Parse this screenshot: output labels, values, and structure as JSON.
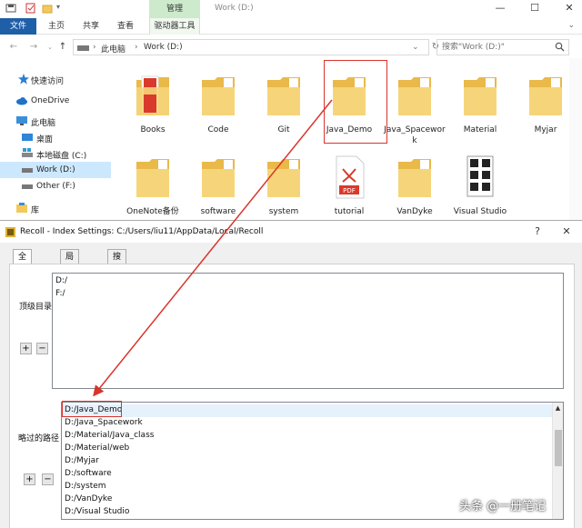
{
  "explorer": {
    "window_title": "Work (D:)",
    "manage_tab": "管理",
    "ribbon_tabs": [
      "文件",
      "主页",
      "共享",
      "查看",
      "驱动器工具"
    ],
    "breadcrumb": [
      "此电脑",
      "Work (D:)"
    ],
    "search_placeholder": "搜索\"Work (D:)\"",
    "nav_items": [
      {
        "label": "快速访问",
        "icon": "star-icon"
      },
      {
        "label": "OneDrive",
        "icon": "cloud-icon"
      },
      {
        "label": "此电脑",
        "icon": "computer-icon"
      },
      {
        "label": "桌面",
        "icon": "desktop-icon"
      },
      {
        "label": "本地磁盘 (C:)",
        "icon": "drive-icon"
      },
      {
        "label": "Work (D:)",
        "icon": "drive-icon"
      },
      {
        "label": "Other (F:)",
        "icon": "drive-icon"
      },
      {
        "label": "库",
        "icon": "library-icon"
      }
    ],
    "folders": [
      {
        "name": "Books",
        "icon": "folder-pdf-icon"
      },
      {
        "name": "Code",
        "icon": "folder-icon"
      },
      {
        "name": "Git",
        "icon": "folder-icon"
      },
      {
        "name": "Java_Demo",
        "icon": "folder-icon"
      },
      {
        "name": "Java_Spacework",
        "icon": "folder-icon"
      },
      {
        "name": "Material",
        "icon": "folder-icon"
      },
      {
        "name": "Myjar",
        "icon": "folder-icon"
      },
      {
        "name": "OneNote备份",
        "icon": "folder-icon"
      },
      {
        "name": "software",
        "icon": "folder-icon"
      },
      {
        "name": "system",
        "icon": "folder-icon"
      },
      {
        "name": "tutorial",
        "icon": "pdf-file-icon"
      },
      {
        "name": "VanDyke",
        "icon": "folder-icon"
      },
      {
        "name": "Visual Studio",
        "icon": "folder-vs-icon"
      }
    ]
  },
  "dialog": {
    "title": "Recoll - Index Settings: C:/Users/liu11/AppData/Local/Recoll",
    "help_label": "?",
    "close_label": "✕",
    "tabs": [
      "全局参数",
      "局部参数",
      "搜索参数"
    ],
    "top_dirs_label": "顶级目录",
    "top_dirs": [
      "D:/",
      "F:/"
    ],
    "skipped_label": "略过的路径",
    "skipped_paths": [
      "D:/Java_Demo",
      "D:/Java_Spacework",
      "D:/Material/Java_class",
      "D:/Material/web",
      "D:/Myjar",
      "D:/software",
      "D:/system",
      "D:/VanDyke",
      "D:/Visual Studio"
    ],
    "add_label": "+",
    "remove_label": "−"
  },
  "watermark": "头条 @一册笔记",
  "colors": {
    "accent": "#1f5fa8",
    "highlight": "#d9342b",
    "selection": "#cce8ff",
    "folder": "#f3c95b"
  }
}
